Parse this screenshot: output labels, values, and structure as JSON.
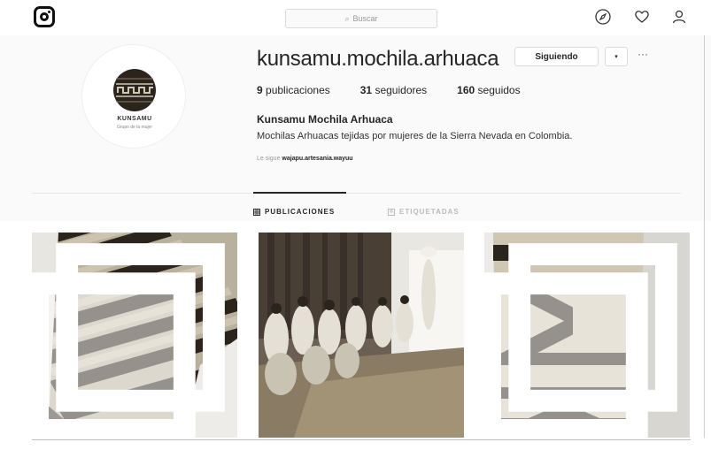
{
  "topbar": {
    "search_placeholder": "Buscar",
    "icons": [
      "instagram-logo-icon",
      "compass-icon",
      "heart-icon",
      "user-icon"
    ]
  },
  "profile": {
    "username": "kunsamu.mochila.arhuaca",
    "follow_button": "Siguiendo",
    "dropdown": "▾",
    "more": "···",
    "avatar_brand": "KUNSAMU",
    "avatar_tag": "Grupo de la mujer",
    "stats": {
      "posts_count": "9",
      "posts_label": "publicaciones",
      "followers_count": "31",
      "followers_label": "seguidores",
      "following_count": "160",
      "following_label": "seguidos"
    },
    "full_name": "Kunsamu Mochila Arhuaca",
    "bio": "Mochilas Arhuacas tejidas por mujeres de la Sierra Nevada en Colombia.",
    "followed_by_prefix": "Le sigue",
    "followed_by_name": "wajapu.artesania.wayuu"
  },
  "tabs": [
    {
      "label": "PUBLICACIONES",
      "active": true
    },
    {
      "label": "ETIQUETADAS",
      "active": false
    }
  ],
  "colors": {
    "text": "#262626",
    "muted": "#999999",
    "border": "#dbdbdb",
    "bag_dark": "#2b241d",
    "bag_light": "#cfc7b3"
  }
}
